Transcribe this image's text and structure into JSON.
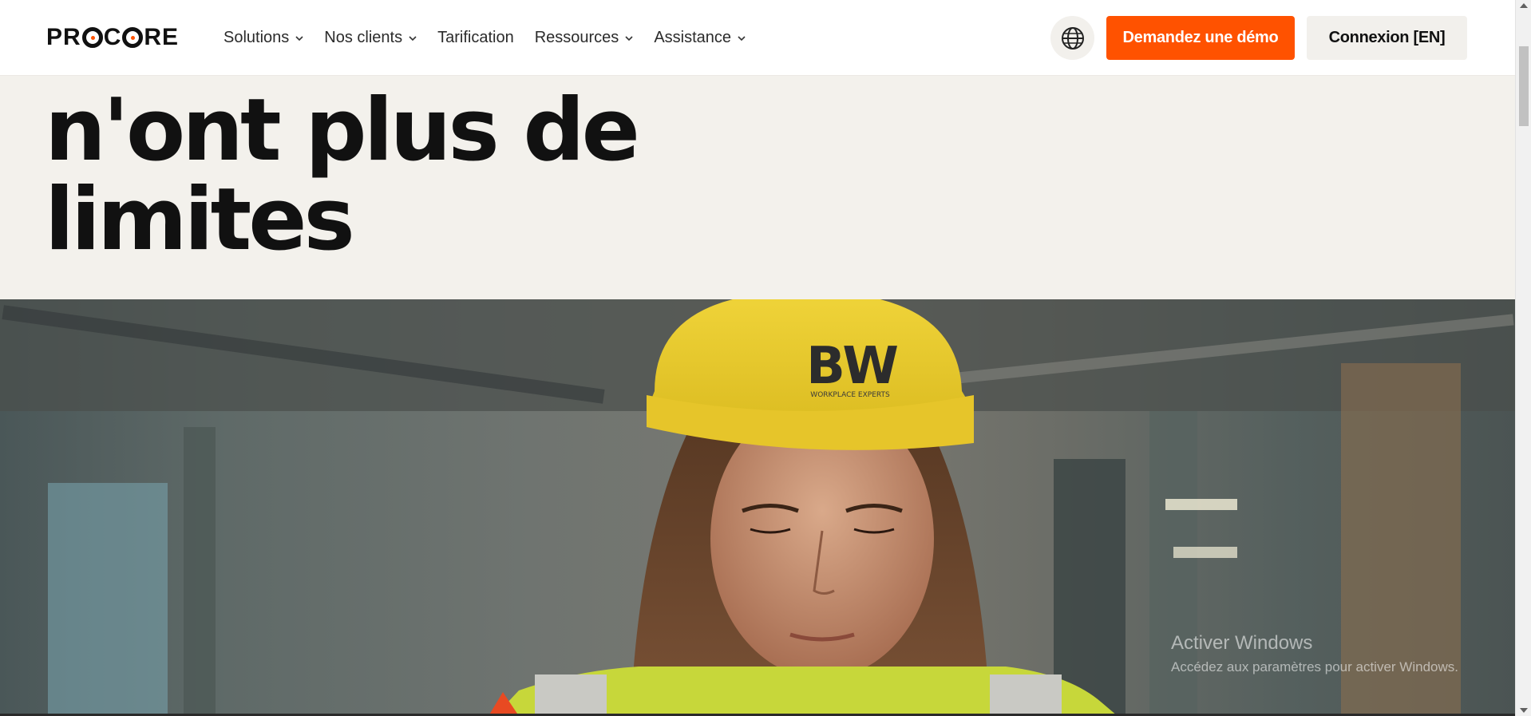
{
  "brand": {
    "name": "PROCORE",
    "accent": "#ff5200"
  },
  "nav": {
    "items": [
      {
        "label": "Solutions",
        "has_dropdown": true
      },
      {
        "label": "Nos clients",
        "has_dropdown": true
      },
      {
        "label": "Tarification",
        "has_dropdown": false
      },
      {
        "label": "Ressources",
        "has_dropdown": true
      },
      {
        "label": "Assistance",
        "has_dropdown": true
      }
    ]
  },
  "header": {
    "globe_icon": "globe-icon",
    "demo_label": "Demandez une démo",
    "login_label": "Connexion [EN]"
  },
  "hero": {
    "line1": "n'ont plus de",
    "line2": "limites"
  },
  "photo": {
    "helmet_text": "BW",
    "helmet_subtext": "WORKPLACE EXPERTS"
  },
  "watermark": {
    "title": "Activer Windows",
    "subtitle": "Accédez aux paramètres pour activer Windows."
  }
}
